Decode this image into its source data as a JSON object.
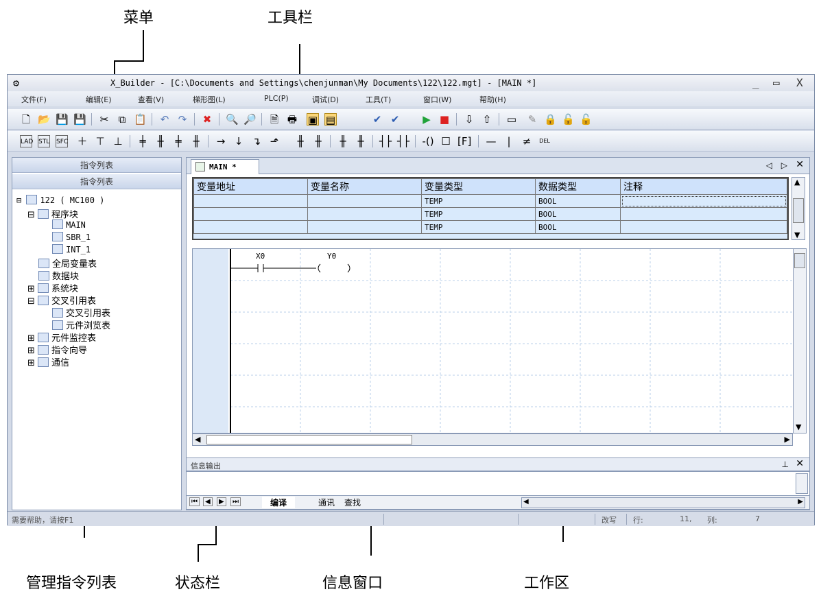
{
  "annotations": {
    "menu": "菜单",
    "toolbar": "工具栏",
    "tree": "管理指令列表",
    "status": "状态栏",
    "info": "信息窗口",
    "work": "工作区"
  },
  "window": {
    "title": "X_Builder - [C:\\Documents and Settings\\chenjunman\\My Documents\\122\\122.mgt] - [MAIN *]",
    "min": "_",
    "max": "▭",
    "close": "X"
  },
  "menu": [
    "文件(F)",
    "编辑(E)",
    "查看(V)",
    "梯形图(L)",
    "PLC(P)",
    "调试(D)",
    "工具(T)",
    "窗口(W)",
    "帮助(H)"
  ],
  "left_panel": {
    "header1": "指令列表",
    "header2": "指令列表",
    "tree": [
      "122 ( MC100 )",
      "程序块",
      "MAIN",
      "SBR_1",
      "INT_1",
      "全局变量表",
      "数据块",
      "系统块",
      "交叉引用表",
      "交叉引用表",
      "元件浏览表",
      "元件监控表",
      "指令向导",
      "通信"
    ]
  },
  "editor": {
    "tab": "MAIN *",
    "table_headers": [
      "变量地址",
      "变量名称",
      "变量类型",
      "数据类型",
      "注释"
    ],
    "rows": [
      [
        "",
        "",
        "TEMP",
        "BOOL",
        ""
      ],
      [
        "",
        "",
        "TEMP",
        "BOOL",
        ""
      ],
      [
        "",
        "",
        "TEMP",
        "BOOL",
        ""
      ]
    ],
    "contact": "X0",
    "coil": "Y0"
  },
  "info": {
    "title": "信息输出",
    "tabs": [
      "编译",
      "通讯",
      "查找"
    ]
  },
  "status": {
    "help": "需要帮助，请按F1",
    "mode": "改写",
    "row_label": "行:",
    "row": "11,",
    "col_label": "列:",
    "col": "7"
  }
}
